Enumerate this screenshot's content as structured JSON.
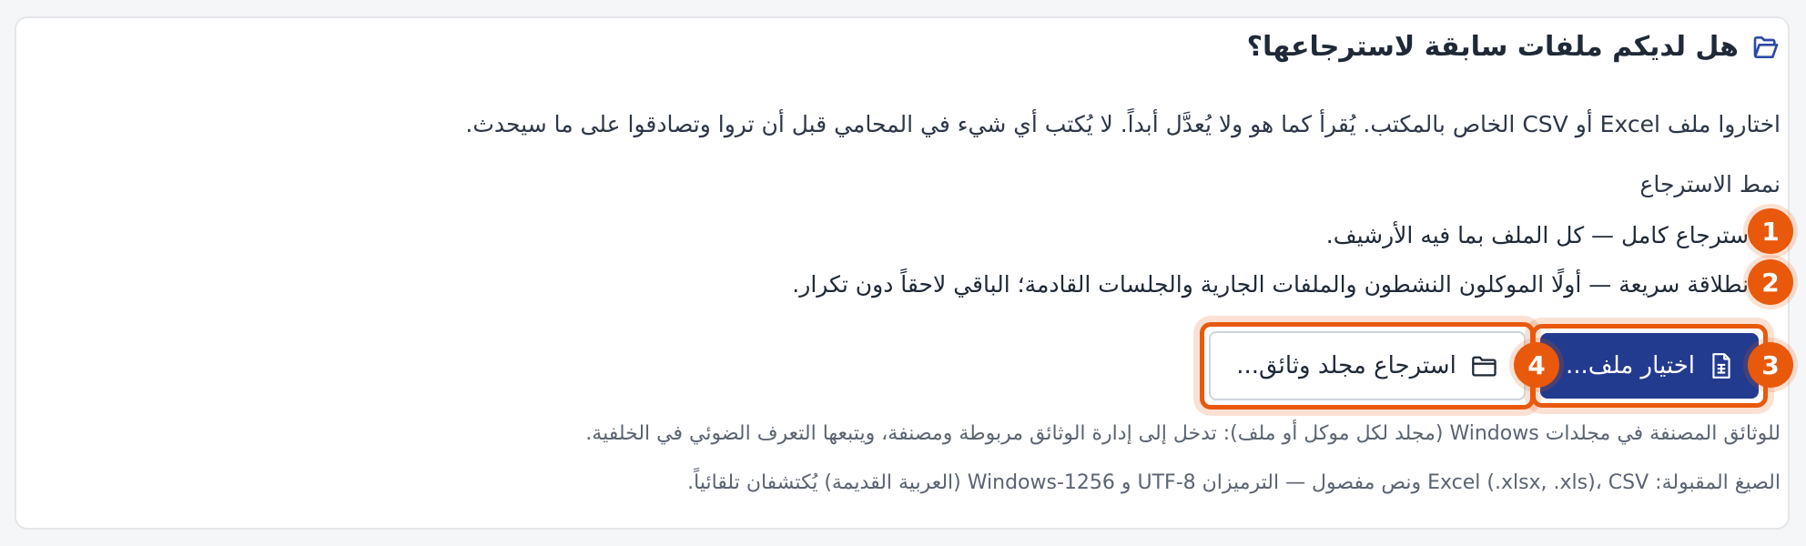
{
  "header": {
    "title": "هل لديكم ملفات سابقة لاسترجاعها؟",
    "icon": "folder-open-icon"
  },
  "description": "اختاروا ملف Excel أو CSV الخاص بالمكتب. يُقرأ كما هو ولا يُعدَّل أبداً. لا يُكتب أي شيء في المحامي قبل أن تروا وتصادقوا على ما سيحدث.",
  "import_mode": {
    "label": "نمط الاسترجاع",
    "options": [
      {
        "label": "استرجاع كامل — كل الملف بما فيه الأرشيف.",
        "checked": true
      },
      {
        "label": "انطلاقة سريعة — أولًا الموكلون النشطون والملفات الجارية والجلسات القادمة؛ الباقي لاحقاً دون تكرار.",
        "checked": false
      }
    ]
  },
  "actions": {
    "choose_file": {
      "label": "اختيار ملف...",
      "icon": "spreadsheet-file-icon"
    },
    "import_folder": {
      "label": "استرجاع مجلد وثائق...",
      "icon": "folder-icon"
    }
  },
  "hints": {
    "folders": "للوثائق المصنفة في مجلدات Windows (مجلد لكل موكل أو ملف): تدخل إلى إدارة الوثائق مربوطة ومصنفة، ويتبعها التعرف الضوئي في الخلفية.",
    "formats": "الصيغ المقبولة: Excel (.xlsx, .xls)، CSV ونص مفصول — الترميزان UTF-8 و Windows-1256 (العربية القديمة) يُكتشفان تلقائياً."
  },
  "annotations": [
    "1",
    "2",
    "3",
    "4"
  ],
  "colors": {
    "primary": "#233b8f",
    "accent": "#2b5be0",
    "highlight": "#e8590c"
  }
}
